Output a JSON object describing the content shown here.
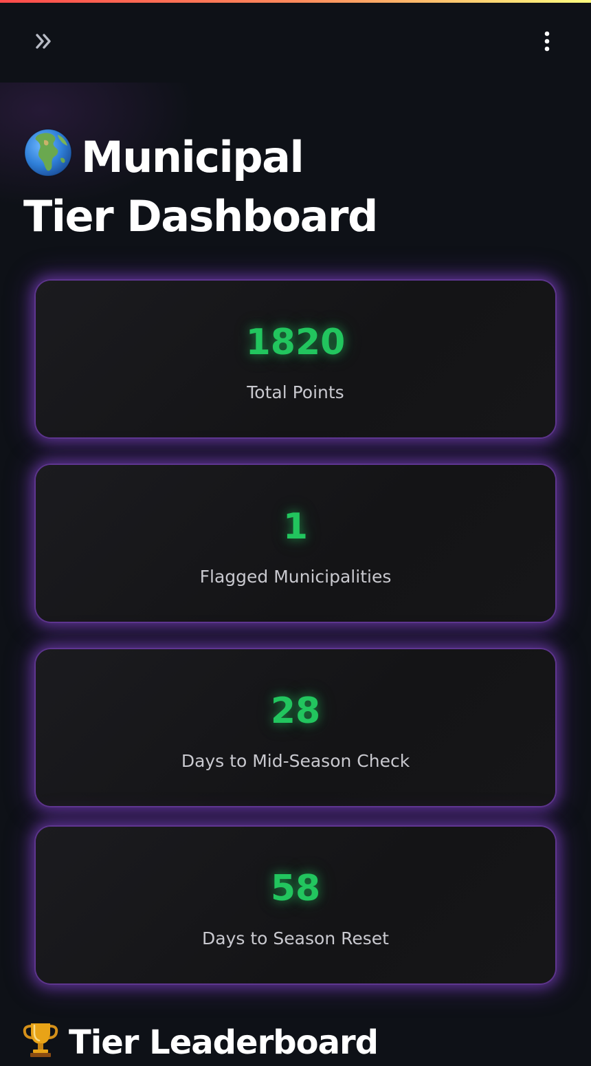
{
  "header": {
    "sidebar_toggle_icon": "chevron-double-right-icon",
    "menu_icon": "kebab-menu-icon"
  },
  "title": {
    "emoji_icon": "globe-icon",
    "line1": "Municipal",
    "line2": "Tier Dashboard"
  },
  "metrics": [
    {
      "value": "1820",
      "label": "Total Points"
    },
    {
      "value": "1",
      "label": "Flagged Municipalities"
    },
    {
      "value": "28",
      "label": "Days to Mid-Season Check"
    },
    {
      "value": "58",
      "label": "Days to Season Reset"
    }
  ],
  "leaderboard": {
    "emoji_icon": "trophy-icon",
    "heading": "Tier Leaderboard"
  },
  "colors": {
    "background": "#0e1117",
    "metric_value": "#22c55e",
    "card_glow": "#8246c8",
    "card_bg": "#161618"
  }
}
